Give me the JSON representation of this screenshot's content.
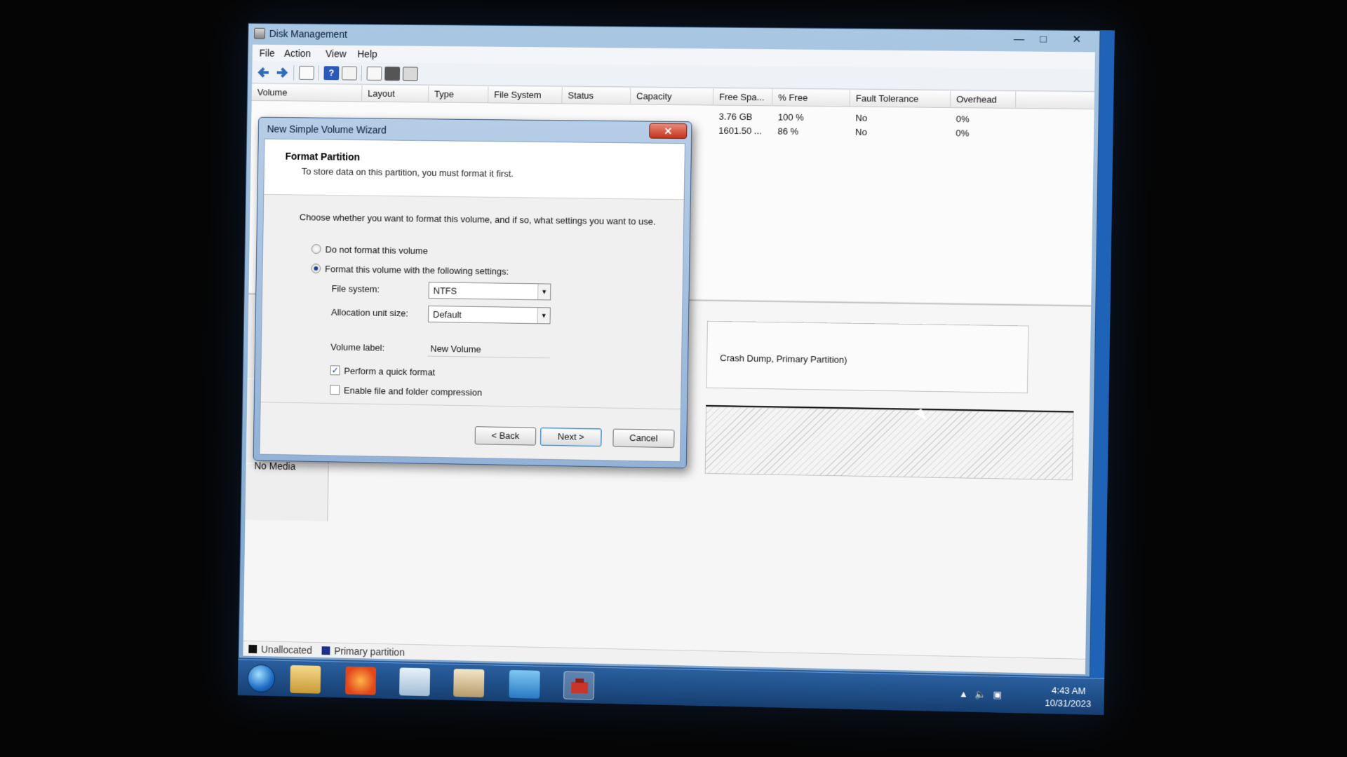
{
  "window": {
    "title": "Disk Management"
  },
  "menu": [
    "File",
    "Action",
    "View",
    "Help"
  ],
  "volume_list": {
    "columns": [
      "Volume",
      "Layout",
      "Type",
      "File System",
      "Status",
      "Capacity",
      "Free Spa...",
      "% Free",
      "Fault Tolerance",
      "Overhead"
    ],
    "rows": [
      {
        "free_space": "3.76 GB",
        "pct_free": "100 %",
        "fault_tolerance": "No",
        "overhead": "0%"
      },
      {
        "free_space": "1601.50 ...",
        "pct_free": "86 %",
        "fault_tolerance": "No",
        "overhead": "0%"
      }
    ]
  },
  "disk_pane": {
    "partition_text": "Crash Dump, Primary Partition)",
    "no_media": "No Media"
  },
  "legend": [
    {
      "label": "Unallocated",
      "color": "#111111"
    },
    {
      "label": "Primary partition",
      "color": "#1c2e8e"
    }
  ],
  "wizard": {
    "title": "New Simple Volume Wizard",
    "header_title": "Format Partition",
    "header_sub": "To store data on this partition, you must format it first.",
    "instruction": "Choose whether you want to format this volume, and if so, what settings you want to use.",
    "radio_no_format": "Do not format this volume",
    "radio_format": "Format this volume with the following settings:",
    "file_system_label": "File system:",
    "file_system_value": "NTFS",
    "alloc_label": "Allocation unit size:",
    "alloc_value": "Default",
    "volume_label_label": "Volume label:",
    "volume_label_value": "New Volume",
    "quick_format": "Perform a quick format",
    "compression": "Enable file and folder compression",
    "back": "< Back",
    "next": "Next >",
    "cancel": "Cancel"
  },
  "taskbar": {
    "time": "4:43 AM",
    "date": "10/31/2023"
  }
}
